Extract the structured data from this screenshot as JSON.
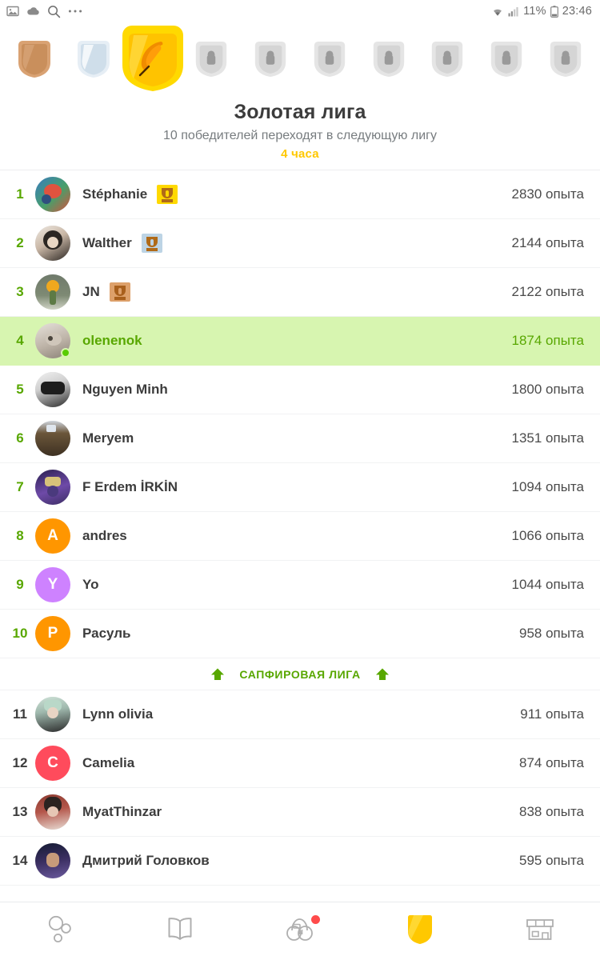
{
  "status_bar": {
    "left_icons": [
      "image-icon",
      "cloud-icon",
      "search-icon",
      "more-icon"
    ],
    "battery_percent": "11%",
    "time": "23:46",
    "right_icons": [
      "wifi-icon",
      "signal-icon",
      "battery-icon"
    ]
  },
  "league_strip": {
    "badges": [
      {
        "name": "bronze-league-badge",
        "state": "completed",
        "tier": "bronze",
        "active": false
      },
      {
        "name": "silver-league-badge",
        "state": "completed",
        "tier": "silver",
        "active": false
      },
      {
        "name": "gold-league-badge",
        "state": "current",
        "tier": "gold",
        "active": true
      },
      {
        "name": "sapphire-league-badge",
        "state": "locked",
        "tier": "locked",
        "active": false
      },
      {
        "name": "ruby-league-badge",
        "state": "locked",
        "tier": "locked",
        "active": false
      },
      {
        "name": "emerald-league-badge",
        "state": "locked",
        "tier": "locked",
        "active": false
      },
      {
        "name": "amethyst-league-badge",
        "state": "locked",
        "tier": "locked",
        "active": false
      },
      {
        "name": "pearl-league-badge",
        "state": "locked",
        "tier": "locked",
        "active": false
      },
      {
        "name": "obsidian-league-badge",
        "state": "locked",
        "tier": "locked",
        "active": false
      },
      {
        "name": "diamond-league-badge",
        "state": "locked",
        "tier": "locked",
        "active": false
      }
    ]
  },
  "header": {
    "title": "Золотая лига",
    "subtitle": "10 победителей переходят в следующую лигу",
    "timer": "4 часа"
  },
  "leaderboard": {
    "rows": [
      {
        "rank": "1",
        "name": "Stéphanie",
        "xp": "2830 опыта",
        "avatar_type": "photo",
        "avatar_colors": [
          "#2f4f7f",
          "#d94f3d",
          "#3a9b6c"
        ],
        "medal": "gold-medal",
        "highlight": false,
        "promoted": true
      },
      {
        "rank": "2",
        "name": "Walther",
        "xp": "2144 опыта",
        "avatar_type": "photo",
        "avatar_colors": [
          "#2b2622",
          "#c9b7a6",
          "#efeae3"
        ],
        "medal": "silver-medal",
        "highlight": false,
        "promoted": true
      },
      {
        "rank": "3",
        "name": "JN",
        "xp": "2122 опыта",
        "avatar_type": "photo",
        "avatar_colors": [
          "#6f7a6b",
          "#f0a81e",
          "#8fae70"
        ],
        "medal": "bronze-medal",
        "highlight": false,
        "promoted": true
      },
      {
        "rank": "4",
        "name": "olenenok",
        "xp": "1874 опыта",
        "avatar_type": "photo",
        "avatar_colors": [
          "#b9b0a6",
          "#e6e1da",
          "#7d7468"
        ],
        "medal": null,
        "highlight": true,
        "promoted": true,
        "online": true
      },
      {
        "rank": "5",
        "name": "Nguyen Minh",
        "xp": "1800 опыта",
        "avatar_type": "photo",
        "avatar_colors": [
          "#1d1d1d",
          "#5a5a5a",
          "#e9e9e9"
        ],
        "medal": null,
        "highlight": false,
        "promoted": true
      },
      {
        "rank": "6",
        "name": "Meryem",
        "xp": "1351 опыта",
        "avatar_type": "photo",
        "avatar_colors": [
          "#4b3a28",
          "#6b563a",
          "#cfd6de"
        ],
        "medal": null,
        "highlight": false,
        "promoted": true
      },
      {
        "rank": "7",
        "name": "F Erdem İRKİN",
        "xp": "1094 опыта",
        "avatar_type": "photo",
        "avatar_colors": [
          "#2a1f4e",
          "#6e4aa8",
          "#d7c27a"
        ],
        "medal": null,
        "highlight": false,
        "promoted": true
      },
      {
        "rank": "8",
        "name": "andres",
        "xp": "1066 опыта",
        "avatar_type": "letter",
        "avatar_letter": "A",
        "avatar_color": "#ff9600",
        "medal": null,
        "highlight": false,
        "promoted": true
      },
      {
        "rank": "9",
        "name": "Yo",
        "xp": "1044 опыта",
        "avatar_type": "letter",
        "avatar_letter": "Y",
        "avatar_color": "#ce82ff",
        "medal": null,
        "highlight": false,
        "promoted": true
      },
      {
        "rank": "10",
        "name": "Расуль",
        "xp": "958 опыта",
        "avatar_type": "letter",
        "avatar_letter": "Р",
        "avatar_color": "#ff9600",
        "medal": null,
        "highlight": false,
        "promoted": true
      }
    ],
    "divider": {
      "label": "САПФИРОВАЯ ЛИГА",
      "arrow_icon": "arrow-up-icon",
      "color": "#58a700"
    },
    "rows_below": [
      {
        "rank": "11",
        "name": "Lynn olivia",
        "xp": "911 опыта",
        "avatar_type": "photo",
        "avatar_colors": [
          "#d6e4dd",
          "#2b2b2b",
          "#9fb8ad"
        ],
        "medal": null,
        "highlight": false,
        "promoted": false
      },
      {
        "rank": "12",
        "name": "Camelia",
        "xp": "874 опыта",
        "avatar_type": "letter",
        "avatar_letter": "C",
        "avatar_color": "#ff4b5c",
        "medal": null,
        "highlight": false,
        "promoted": false
      },
      {
        "rank": "13",
        "name": "MyatThinzar",
        "xp": "838 опыта",
        "avatar_type": "photo",
        "avatar_colors": [
          "#8c3b30",
          "#2b2320",
          "#e8dcd4"
        ],
        "medal": null,
        "highlight": false,
        "promoted": false
      },
      {
        "rank": "14",
        "name": "Дмитрий Головков",
        "xp": "595 опыта",
        "avatar_type": "photo",
        "avatar_colors": [
          "#151b33",
          "#6b5a9e",
          "#c79b7a"
        ],
        "medal": null,
        "highlight": false,
        "promoted": false
      }
    ]
  },
  "bottom_nav": {
    "items": [
      {
        "name": "nav-learn",
        "icon": "circles-tree-icon",
        "active": false,
        "badge": false
      },
      {
        "name": "nav-stories",
        "icon": "open-book-icon",
        "active": false,
        "badge": false
      },
      {
        "name": "nav-profile",
        "icon": "owl-character-icon",
        "active": false,
        "badge": true
      },
      {
        "name": "nav-leagues",
        "icon": "gold-shield-icon",
        "active": true,
        "badge": false
      },
      {
        "name": "nav-shop",
        "icon": "store-icon",
        "active": false,
        "badge": false
      }
    ]
  },
  "colors": {
    "green": "#58a700",
    "green_bright": "#58cc02",
    "highlight_bg": "#d7f5b0",
    "gold": "#ffc800",
    "gold_bright": "#ffd900",
    "text": "#3c3c3c",
    "muted": "#777c7f",
    "red": "#ff4b4b"
  }
}
